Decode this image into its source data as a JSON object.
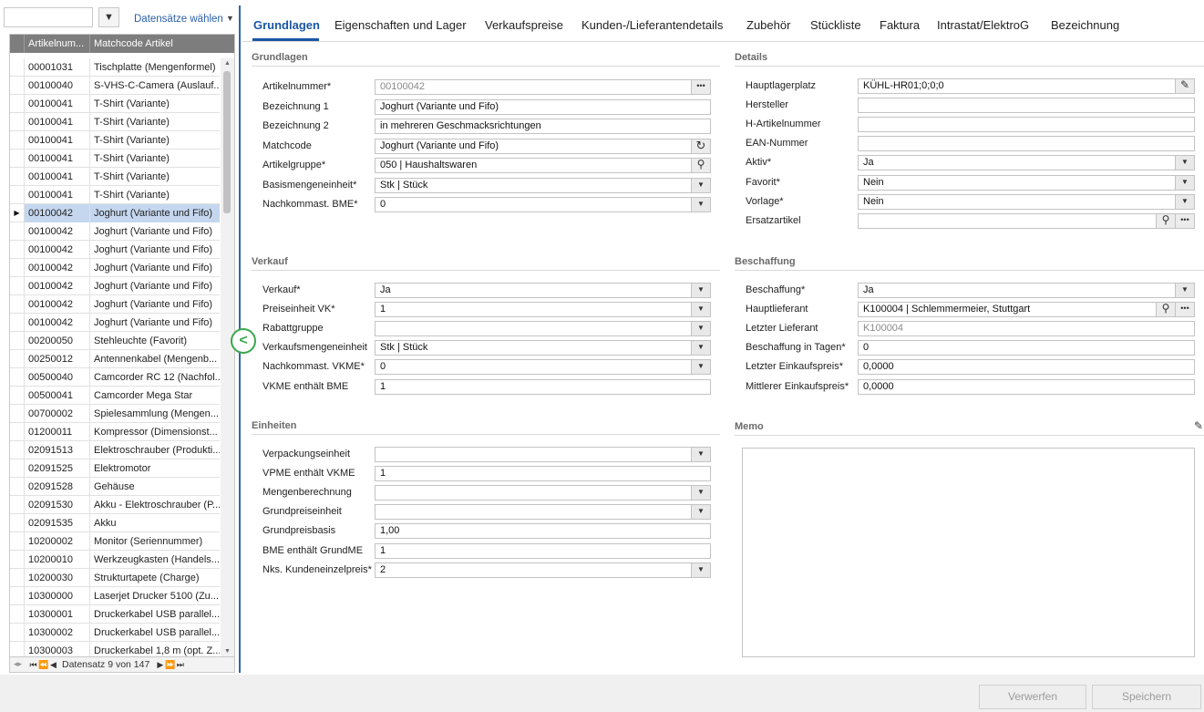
{
  "left_panel": {
    "search_value": "",
    "select_link": "Datensätze wählen",
    "columns": [
      "Artikelnum...",
      "Matchcode Artikel"
    ],
    "rows": [
      [
        "00001031",
        "Tischplatte (Mengenformel)"
      ],
      [
        "00100040",
        "S-VHS-C-Camera (Auslauf..."
      ],
      [
        "00100041",
        "T-Shirt (Variante)"
      ],
      [
        "00100041",
        "T-Shirt (Variante)"
      ],
      [
        "00100041",
        "T-Shirt (Variante)"
      ],
      [
        "00100041",
        "T-Shirt (Variante)"
      ],
      [
        "00100041",
        "T-Shirt (Variante)"
      ],
      [
        "00100041",
        "T-Shirt (Variante)"
      ],
      [
        "00100042",
        "Joghurt (Variante und Fifo)"
      ],
      [
        "00100042",
        "Joghurt (Variante und Fifo)"
      ],
      [
        "00100042",
        "Joghurt (Variante und Fifo)"
      ],
      [
        "00100042",
        "Joghurt (Variante und Fifo)"
      ],
      [
        "00100042",
        "Joghurt (Variante und Fifo)"
      ],
      [
        "00100042",
        "Joghurt (Variante und Fifo)"
      ],
      [
        "00100042",
        "Joghurt (Variante und Fifo)"
      ],
      [
        "00200050",
        "Stehleuchte  (Favorit)"
      ],
      [
        "00250012",
        "Antennenkabel (Mengenb..."
      ],
      [
        "00500040",
        "Camcorder RC 12 (Nachfol..."
      ],
      [
        "00500041",
        "Camcorder Mega Star"
      ],
      [
        "00700002",
        "Spielesammlung (Mengen..."
      ],
      [
        "01200011",
        "Kompressor (Dimensionst..."
      ],
      [
        "02091513",
        "Elektroschrauber (Produkti..."
      ],
      [
        "02091525",
        "Elektromotor"
      ],
      [
        "02091528",
        "Gehäuse"
      ],
      [
        "02091530",
        "Akku - Elektroschrauber (P..."
      ],
      [
        "02091535",
        "Akku"
      ],
      [
        "10200002",
        "Monitor (Seriennummer)"
      ],
      [
        "10200010",
        "Werkzeugkasten (Handels..."
      ],
      [
        "10200030",
        "Strukturtapete (Charge)"
      ],
      [
        "10300000",
        "Laserjet Drucker 5100 (Zu..."
      ],
      [
        "10300001",
        "Druckerkabel USB parallel..."
      ],
      [
        "10300002",
        "Druckerkabel USB parallel..."
      ],
      [
        "10300003",
        "Druckerkabel 1,8 m (opt. Z..."
      ]
    ],
    "selected_index": 8,
    "record_text": "Datensatz 9 von 147"
  },
  "tabs": [
    "Grundlagen",
    "Eigenschaften und Lager",
    "Verkaufspreise",
    "Kunden-/Lieferantendetails",
    "Zubehör",
    "Stückliste",
    "Faktura",
    "Intrastat/ElektroG",
    "Bezeichnung"
  ],
  "active_tab": "Grundlagen",
  "sections": {
    "grundlagen": {
      "title": "Grundlagen",
      "fields": [
        {
          "label": "Artikelnummer*",
          "value": "00100042",
          "readonly": true,
          "button": "ellipsis"
        },
        {
          "label": "Bezeichnung 1",
          "value": "Joghurt (Variante und Fifo)"
        },
        {
          "label": "Bezeichnung 2",
          "value": "in mehreren Geschmacksrichtungen"
        },
        {
          "label": "Matchcode",
          "value": "Joghurt (Variante und Fifo)",
          "button": "refresh"
        },
        {
          "label": "Artikelgruppe*",
          "value": "050 | Haushaltswaren",
          "button": "search"
        },
        {
          "label": "Basismengeneinheit*",
          "value": "Stk  |  Stück",
          "button": "dropdown"
        },
        {
          "label": "Nachkommast. BME*",
          "value": "0",
          "button": "dropdown"
        }
      ]
    },
    "details": {
      "title": "Details",
      "fields": [
        {
          "label": "Hauptlagerplatz",
          "value": "KÜHL-HR01;0;0;0",
          "button": "pencil"
        },
        {
          "label": "Hersteller",
          "value": ""
        },
        {
          "label": "H-Artikelnummer",
          "value": ""
        },
        {
          "label": "EAN-Nummer",
          "value": ""
        },
        {
          "label": "Aktiv*",
          "value": "Ja",
          "button": "dropdown"
        },
        {
          "label": "Favorit*",
          "value": "Nein",
          "button": "dropdown"
        },
        {
          "label": "Vorlage*",
          "value": "Nein",
          "button": "dropdown"
        },
        {
          "label": "Ersatzartikel",
          "value": "",
          "button": "search+ellipsis"
        }
      ]
    },
    "verkauf": {
      "title": "Verkauf",
      "fields": [
        {
          "label": "Verkauf*",
          "value": "Ja",
          "button": "dropdown"
        },
        {
          "label": "Preiseinheit VK*",
          "value": "1",
          "button": "dropdown"
        },
        {
          "label": "Rabattgruppe",
          "value": "",
          "button": "dropdown"
        },
        {
          "label": "Verkaufsmengeneinheit",
          "value": "Stk  |  Stück",
          "button": "dropdown"
        },
        {
          "label": "Nachkommast. VKME*",
          "value": "0",
          "button": "dropdown"
        },
        {
          "label": "VKME enthält BME",
          "value": "1"
        }
      ]
    },
    "beschaffung": {
      "title": "Beschaffung",
      "fields": [
        {
          "label": "Beschaffung*",
          "value": "Ja",
          "button": "dropdown"
        },
        {
          "label": "Hauptlieferant",
          "value": "K100004  |  Schlemmermeier, Stuttgart",
          "button": "search+ellipsis"
        },
        {
          "label": "Letzter Lieferant",
          "value": "K100004",
          "readonly": true
        },
        {
          "label": "Beschaffung in Tagen*",
          "value": "0"
        },
        {
          "label": "Letzter Einkaufspreis*",
          "value": "0,0000"
        },
        {
          "label": "Mittlerer Einkaufspreis*",
          "value": "0,0000"
        }
      ]
    },
    "einheiten": {
      "title": "Einheiten",
      "fields": [
        {
          "label": "Verpackungseinheit",
          "value": "",
          "button": "dropdown"
        },
        {
          "label": "VPME enthält VKME",
          "value": "1"
        },
        {
          "label": "Mengenberechnung",
          "value": "",
          "button": "dropdown"
        },
        {
          "label": "Grundpreiseinheit",
          "value": "",
          "button": "dropdown"
        },
        {
          "label": "Grundpreisbasis",
          "value": "1,00"
        },
        {
          "label": "BME enthält GrundME",
          "value": "1"
        },
        {
          "label": "Nks. Kundeneinzelpreis*",
          "value": "2",
          "button": "dropdown"
        }
      ]
    },
    "memo": {
      "title": "Memo",
      "value": ""
    }
  },
  "footer": {
    "discard": "Verwerfen",
    "save": "Speichern"
  },
  "colors": {
    "accent": "#1a56a5",
    "selected_row": "#c5d7ef",
    "collapse_green": "#3aa84c",
    "header_gray": "#7d7d7d"
  }
}
